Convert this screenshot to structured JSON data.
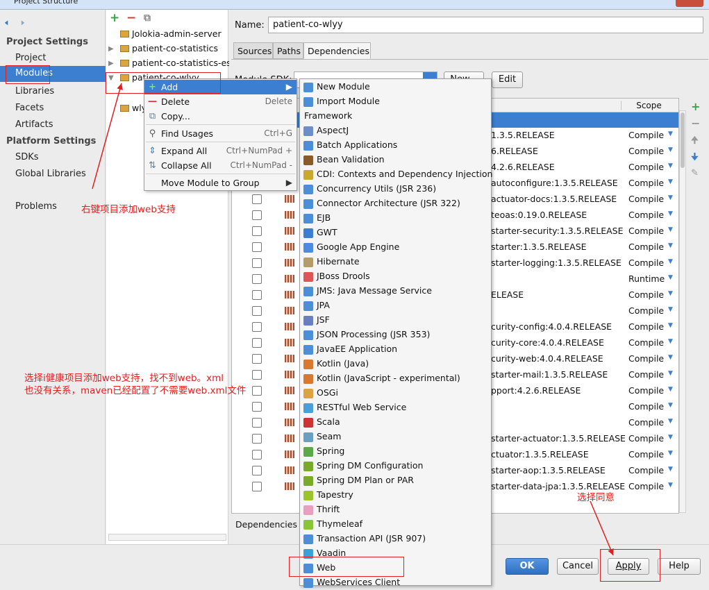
{
  "window": {
    "title": "Project Structure"
  },
  "left": {
    "back_icon": "back-arrow-icon",
    "forward_icon": "forward-arrow-icon",
    "project_settings": "Project Settings",
    "items_ps": [
      "Project",
      "Modules",
      "Libraries",
      "Facets",
      "Artifacts"
    ],
    "platform_settings": "Platform Settings",
    "items_plat": [
      "SDKs",
      "Global Libraries"
    ],
    "problems": "Problems"
  },
  "tree": {
    "items": [
      "Jolokia-admin-server",
      "patient-co-statistics",
      "patient-co-statistics-es",
      "patient-co-wlyy",
      "wly"
    ]
  },
  "main": {
    "name_label": "Name:",
    "name_value": "patient-co-wlyy",
    "tabs": [
      "Sources",
      "Paths",
      "Dependencies"
    ],
    "module_sdk_label": "Module SDK:",
    "new_button": "New...",
    "edit_button": "Edit",
    "scope_header": "Scope",
    "storage_label": "Dependencies storage format:"
  },
  "rows": [
    {
      "dep": "1.3.5.RELEASE",
      "scope": "Compile",
      "cb": false
    },
    {
      "dep": "6.RELEASE",
      "scope": "Compile",
      "cb": false
    },
    {
      "dep": "4.2.6.RELEASE",
      "scope": "Compile",
      "cb": false
    },
    {
      "dep": "autoconfigure:1.3.5.RELEASE",
      "scope": "Compile",
      "cb": true
    },
    {
      "dep": "actuator-docs:1.3.5.RELEASE",
      "scope": "Compile",
      "cb": true
    },
    {
      "dep": "teoas:0.19.0.RELEASE",
      "scope": "Compile",
      "cb": true
    },
    {
      "dep": "starter-security:1.3.5.RELEASE",
      "scope": "Compile",
      "cb": true
    },
    {
      "dep": "starter:1.3.5.RELEASE",
      "scope": "Compile",
      "cb": true
    },
    {
      "dep": "starter-logging:1.3.5.RELEASE",
      "scope": "Compile",
      "cb": true
    },
    {
      "dep": "",
      "scope": "Runtime",
      "cb": true
    },
    {
      "dep": "ELEASE",
      "scope": "Compile",
      "cb": true
    },
    {
      "dep": "",
      "scope": "Compile",
      "cb": true
    },
    {
      "dep": "curity-config:4.0.4.RELEASE",
      "scope": "Compile",
      "cb": true
    },
    {
      "dep": "curity-core:4.0.4.RELEASE",
      "scope": "Compile",
      "cb": true
    },
    {
      "dep": "curity-web:4.0.4.RELEASE",
      "scope": "Compile",
      "cb": true
    },
    {
      "dep": "starter-mail:1.3.5.RELEASE",
      "scope": "Compile",
      "cb": true
    },
    {
      "dep": "pport:4.2.6.RELEASE",
      "scope": "Compile",
      "cb": true
    },
    {
      "dep": "",
      "scope": "Compile",
      "cb": true
    },
    {
      "dep": "",
      "scope": "Compile",
      "cb": true
    },
    {
      "dep": "starter-actuator:1.3.5.RELEASE",
      "scope": "Compile",
      "cb": true
    },
    {
      "dep": "ctuator:1.3.5.RELEASE",
      "scope": "Compile",
      "cb": true
    },
    {
      "dep": "starter-aop:1.3.5.RELEASE",
      "scope": "Compile",
      "cb": true
    },
    {
      "dep": "starter-data-jpa:1.3.5.RELEASE",
      "scope": "Compile",
      "cb": true
    }
  ],
  "context_menu": {
    "items": [
      {
        "label": "Add",
        "shortcut": "",
        "icon": "plus-icon"
      },
      {
        "label": "Delete",
        "shortcut": "Delete",
        "icon": "minus-icon"
      },
      {
        "label": "Copy...",
        "shortcut": "",
        "icon": "copy-icon"
      },
      {
        "label": "Find Usages",
        "shortcut": "Ctrl+G",
        "icon": "magnifier-icon"
      },
      {
        "label": "Expand All",
        "shortcut": "Ctrl+NumPad +",
        "icon": "expand-icon"
      },
      {
        "label": "Collapse All",
        "shortcut": "Ctrl+NumPad -",
        "icon": "collapse-icon"
      },
      {
        "label": "Move Module to Group",
        "shortcut": "",
        "icon": ""
      }
    ]
  },
  "submenu": {
    "top": [
      "New Module",
      "Import Module"
    ],
    "header": "Framework",
    "frameworks": [
      "AspectJ",
      "Batch Applications",
      "Bean Validation",
      "CDI: Contexts and Dependency Injection",
      "Concurrency Utils (JSR 236)",
      "Connector Architecture (JSR 322)",
      "EJB",
      "GWT",
      "Google App Engine",
      "Hibernate",
      "JBoss Drools",
      "JMS: Java Message Service",
      "JPA",
      "JSF",
      "JSON Processing (JSR 353)",
      "JavaEE Application",
      "Kotlin (Java)",
      "Kotlin (JavaScript - experimental)",
      "OSGi",
      "RESTful Web Service",
      "Scala",
      "Seam",
      "Spring",
      "Spring DM Configuration",
      "Spring DM Plan or PAR",
      "Tapestry",
      "Thrift",
      "Thymeleaf",
      "Transaction API (JSR 907)",
      "Vaadin",
      "Web",
      "WebServices Client"
    ]
  },
  "buttons": {
    "ok": "OK",
    "cancel": "Cancel",
    "apply": "Apply",
    "help": "Help"
  },
  "annotations": {
    "note1": "右键项目添加web支持",
    "note2_line1": "选择i健康项目添加web支持，找不到web。xml",
    "note2_line2": "也没有关系，maven已经配置了不需要web.xml文件",
    "note3": "选择同意"
  },
  "colors": {
    "accent": "#3c7fd0",
    "annotation": "#e02020"
  }
}
